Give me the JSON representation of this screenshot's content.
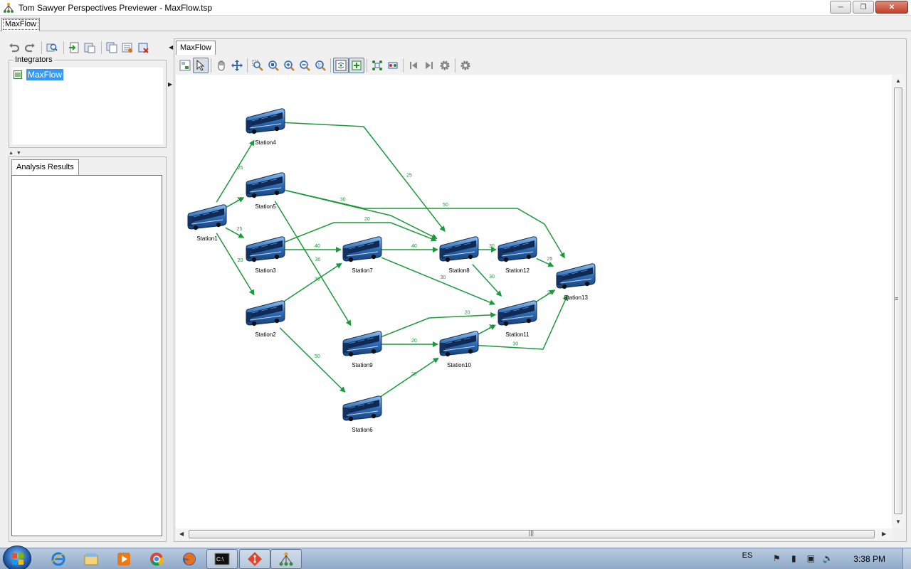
{
  "window": {
    "title": "Tom Sawyer Perspectives Previewer - MaxFlow.tsp",
    "controls": {
      "minimize": "minimize-icon",
      "restore": "restore-icon",
      "close": "close-icon"
    }
  },
  "outer_tab": {
    "label": "MaxFlow"
  },
  "left_toolbar": {
    "icons": [
      "undo-icon",
      "redo-icon",
      "find-icon",
      "import-icon",
      "export-icon",
      "copy-icon",
      "properties-icon",
      "delete-icon"
    ]
  },
  "integrators": {
    "title": "Integrators",
    "items": [
      {
        "label": "MaxFlow",
        "icon": "integrator-icon",
        "selected": true
      }
    ]
  },
  "analysis": {
    "tab_label": "Analysis Results"
  },
  "inner_tab": {
    "label": "MaxFlow"
  },
  "graph_toolbar": {
    "icons": [
      "overview-icon",
      "select-icon",
      "pan-icon",
      "move-icon",
      "zoom-area-icon",
      "zoom-to-fit-icon",
      "zoom-in-icon",
      "zoom-out-icon",
      "zoom-actual-icon",
      "fit-window-icon",
      "layout-icon",
      "incremental-layout-icon",
      "apply-layout-icon",
      "first-icon",
      "last-icon",
      "settings-icon",
      "options-icon"
    ]
  },
  "graph": {
    "nodes": [
      {
        "id": "n1",
        "label": "Station1"
      },
      {
        "id": "n2",
        "label": "Station2"
      },
      {
        "id": "n3",
        "label": "Station3"
      },
      {
        "id": "n4",
        "label": "Station4"
      },
      {
        "id": "n5",
        "label": "Station5"
      },
      {
        "id": "n6",
        "label": "Station6"
      },
      {
        "id": "n7",
        "label": "Station7"
      },
      {
        "id": "n8",
        "label": "Station8"
      },
      {
        "id": "n9",
        "label": "Station9"
      },
      {
        "id": "n10",
        "label": "Station10"
      },
      {
        "id": "n11",
        "label": "Station11"
      },
      {
        "id": "n12",
        "label": "Station12"
      },
      {
        "id": "n13",
        "label": "Station13"
      }
    ],
    "edges": [
      {
        "from": "n1",
        "to": "n4",
        "capacity": "25"
      },
      {
        "from": "n1",
        "to": "n5",
        "capacity": "30"
      },
      {
        "from": "n1",
        "to": "n3",
        "capacity": "25"
      },
      {
        "from": "n1",
        "to": "n2",
        "capacity": "20"
      },
      {
        "from": "n4",
        "to": "n8",
        "capacity": "25"
      },
      {
        "from": "n5",
        "to": "n13",
        "capacity": "50"
      },
      {
        "from": "n5",
        "to": "n8",
        "capacity": "30"
      },
      {
        "from": "n5",
        "to": "n9",
        "capacity": "30"
      },
      {
        "from": "n3",
        "to": "n7",
        "capacity": "40"
      },
      {
        "from": "n3",
        "to": "n8",
        "capacity": "20"
      },
      {
        "from": "n2",
        "to": "n7",
        "capacity": "30"
      },
      {
        "from": "n2",
        "to": "n6",
        "capacity": "50"
      },
      {
        "from": "n7",
        "to": "n8",
        "capacity": "40"
      },
      {
        "from": "n7",
        "to": "n11",
        "capacity": "30"
      },
      {
        "from": "n8",
        "to": "n12",
        "capacity": "30"
      },
      {
        "from": "n8",
        "to": "n11",
        "capacity": "30"
      },
      {
        "from": "n12",
        "to": "n13",
        "capacity": "25"
      },
      {
        "from": "n11",
        "to": "n13",
        "capacity": "20"
      },
      {
        "from": "n9",
        "to": "n11",
        "capacity": "20"
      },
      {
        "from": "n9",
        "to": "n10",
        "capacity": "20"
      },
      {
        "from": "n10",
        "to": "n11",
        "capacity": "30"
      },
      {
        "from": "n10",
        "to": "n13",
        "capacity": "30"
      },
      {
        "from": "n6",
        "to": "n10",
        "capacity": "20"
      }
    ],
    "colors": {
      "edge": "#1a9a3a",
      "label": "#1a9a3a",
      "bus_body": "#2f6db5",
      "bus_window": "#0e2a55"
    }
  },
  "taskbar": {
    "apps": [
      "start-orb-icon",
      "internet-explorer-icon",
      "file-explorer-icon",
      "media-player-icon",
      "chrome-icon",
      "firefox-icon",
      "console-icon",
      "git-icon",
      "perspectives-icon"
    ],
    "language": "ES",
    "clock": "3:38 PM"
  }
}
